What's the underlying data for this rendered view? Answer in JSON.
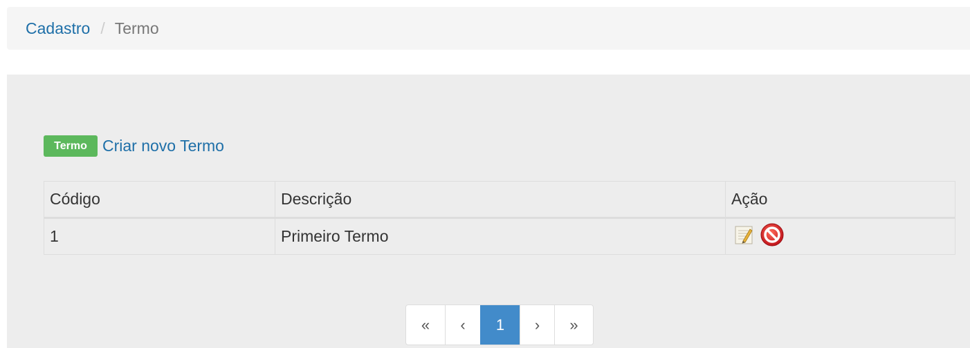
{
  "breadcrumb": {
    "parent": "Cadastro",
    "separator": "/",
    "current": "Termo"
  },
  "create": {
    "badge": "Termo",
    "link": "Criar novo Termo",
    "badge_color": "#5cb85c"
  },
  "table": {
    "headers": [
      "Código",
      "Descrição",
      "Ação"
    ],
    "rows": [
      {
        "codigo": "1",
        "descricao": "Primeiro Termo",
        "actions": [
          "edit-icon",
          "delete-icon"
        ]
      }
    ]
  },
  "pagination": {
    "first": "«",
    "prev": "‹",
    "current": "1",
    "next": "›",
    "last": "»",
    "active_color": "#428bca"
  },
  "colors": {
    "link": "#1e6fa8",
    "panel_bg": "#ededed",
    "breadcrumb_bg": "#f5f5f5"
  }
}
